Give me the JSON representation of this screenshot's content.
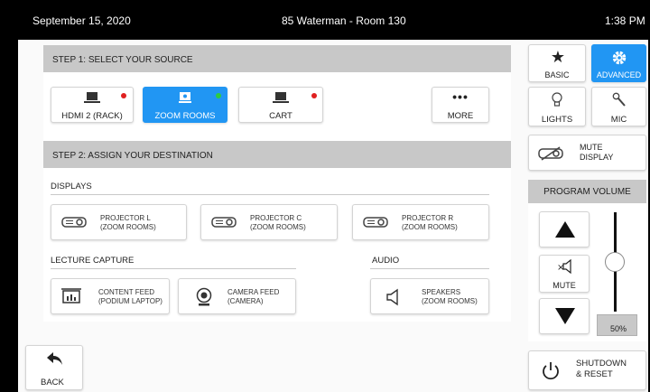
{
  "header": {
    "date": "September 15, 2020",
    "room": "85 Waterman - Room 130",
    "time": "1:38 PM"
  },
  "step1": {
    "label": "STEP 1: SELECT YOUR SOURCE"
  },
  "sources": [
    {
      "label": "HDMI 2 (RACK)",
      "icon": "laptop-icon",
      "status": "red"
    },
    {
      "label": "ZOOM ROOMS",
      "icon": "zoom-rooms-icon",
      "status": "green",
      "selected": true
    },
    {
      "label": "CART",
      "icon": "laptop-icon",
      "status": "red"
    },
    {
      "label": "MORE",
      "icon": "more-icon"
    }
  ],
  "step2": {
    "label": "STEP 2: ASSIGN YOUR DESTINATION"
  },
  "displays": {
    "label": "DISPLAYS",
    "items": [
      {
        "name": "PROJECTOR L",
        "sub": "(ZOOM ROOMS)"
      },
      {
        "name": "PROJECTOR C",
        "sub": "(ZOOM ROOMS)"
      },
      {
        "name": "PROJECTOR R",
        "sub": "(ZOOM ROOMS)"
      }
    ]
  },
  "lecture": {
    "label": "LECTURE CAPTURE",
    "items": [
      {
        "name": "CONTENT FEED",
        "sub": "(PODIUM LAPTOP)"
      },
      {
        "name": "CAMERA FEED",
        "sub": "(CAMERA)"
      }
    ]
  },
  "audio": {
    "label": "AUDIO",
    "items": [
      {
        "name": "SPEAKERS",
        "sub": "(ZOOM ROOMS)"
      }
    ]
  },
  "back": {
    "label": "BACK"
  },
  "modes": {
    "basic": "BASIC",
    "advanced": "ADVANCED"
  },
  "lights": {
    "label": "LIGHTS"
  },
  "mic": {
    "label": "MIC"
  },
  "mute_display": {
    "line1": "MUTE",
    "line2": "DISPLAY"
  },
  "volume": {
    "label": "PROGRAM VOLUME",
    "mute_label": "MUTE",
    "level_text": "50%",
    "level": 0.5
  },
  "shutdown": {
    "line1": "SHUTDOWN",
    "line2": "& RESET"
  },
  "colors": {
    "accent": "#2196f3",
    "status_red": "#e02020",
    "status_green": "#2ecc40",
    "header_bg": "#000000",
    "step_bg": "#c8c8c8"
  }
}
